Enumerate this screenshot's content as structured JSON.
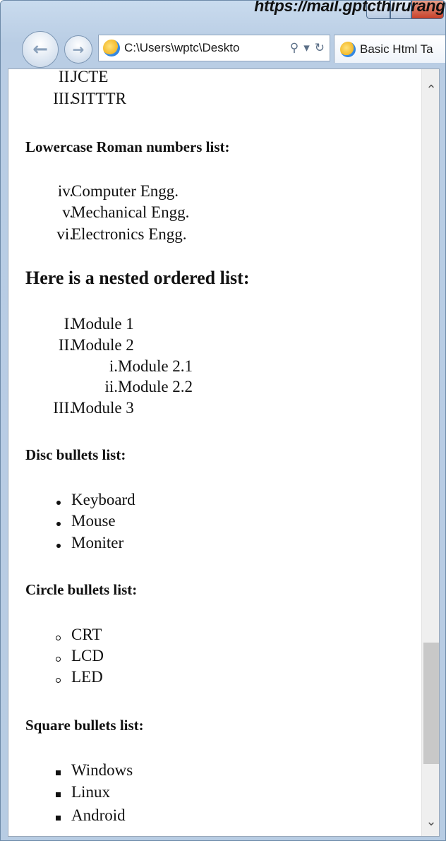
{
  "watermark": "https://mail.gptcthirurang",
  "address_bar": {
    "url": "C:\\Users\\wptc\\Deskto",
    "search_glyph": "⚲",
    "dropdown_glyph": "▾",
    "refresh_glyph": "↻"
  },
  "nav": {
    "back_glyph": "←",
    "forward_glyph": "→"
  },
  "tab": {
    "title": "Basic Html Ta"
  },
  "content": {
    "top_list": [
      {
        "num": "II.",
        "text": "JCTE"
      },
      {
        "num": "III.",
        "text": "SITTTR"
      }
    ],
    "lower_roman_heading": "Lowercase Roman numbers list:",
    "lower_roman_items": [
      {
        "num": "iv.",
        "text": "Computer Engg."
      },
      {
        "num": "v.",
        "text": "Mechanical Engg."
      },
      {
        "num": "vi.",
        "text": "Electronics Engg."
      }
    ],
    "nested_heading": "Here is a nested ordered list:",
    "nested_items": [
      {
        "num": "I.",
        "text": "Module 1"
      },
      {
        "num": "II.",
        "text": "Module 2"
      },
      {
        "num": "i.",
        "text": "Module 2.1"
      },
      {
        "num": "ii.",
        "text": "Module 2.2"
      },
      {
        "num": "III.",
        "text": "Module 3"
      }
    ],
    "disc_heading": "Disc bullets list:",
    "disc_items": [
      "Keyboard",
      "Mouse",
      "Moniter"
    ],
    "circle_heading": "Circle bullets list:",
    "circle_items": [
      "CRT",
      "LCD",
      "LED"
    ],
    "square_heading": "Square bullets list:",
    "square_items": [
      "Windows",
      "Linux",
      "Android"
    ]
  },
  "scrollbar": {
    "up_glyph": "⌃",
    "down_glyph": "⌄"
  }
}
